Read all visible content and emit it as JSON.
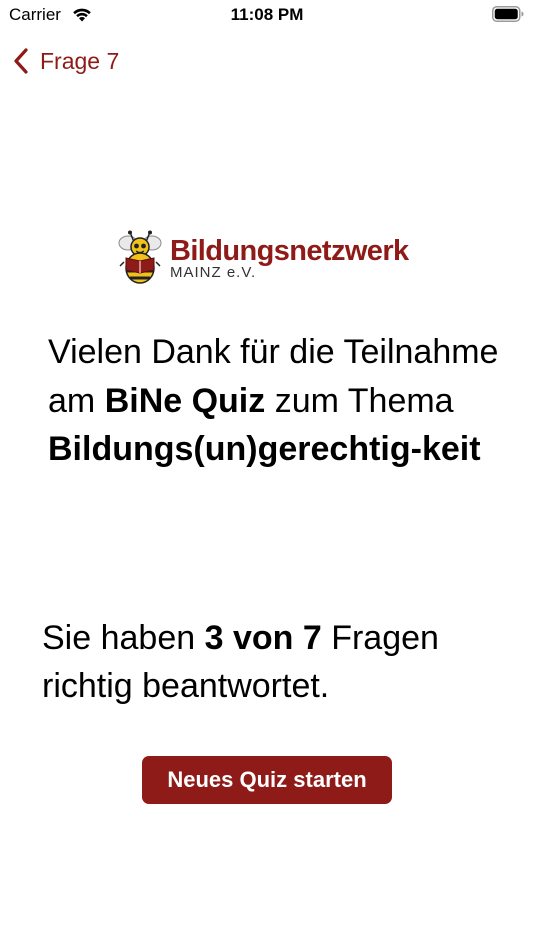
{
  "status_bar": {
    "carrier": "Carrier",
    "time": "11:08 PM",
    "wifi_icon": "wifi-icon",
    "battery_icon": "battery-icon"
  },
  "nav": {
    "back_icon": "chevron-left-icon",
    "back_label": "Frage 7"
  },
  "logo": {
    "name": "Bildungsnetzwerk",
    "subtitle": "MAINZ e.V.",
    "icon": "bee-logo-icon"
  },
  "thanks": {
    "part1": "Vielen Dank für die Teilnahme am ",
    "bold1": "BiNe Quiz",
    "part2": " zum Thema ",
    "bold2": "Bildungs(un)gerechtig-keit"
  },
  "result": {
    "prefix": "Sie haben ",
    "score": "3 von 7",
    "suffix": " Fragen richtig beantwortet.",
    "correct": 3,
    "total": 7
  },
  "actions": {
    "new_quiz_label": "Neues Quiz starten"
  },
  "colors": {
    "accent": "#8e1b17",
    "text": "#000000",
    "background": "#ffffff"
  }
}
